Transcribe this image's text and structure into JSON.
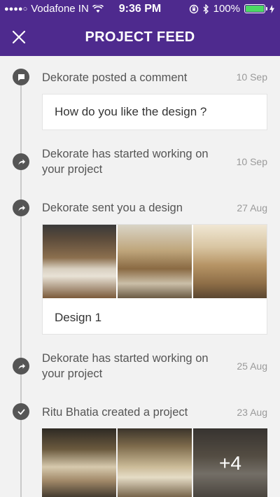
{
  "status_bar": {
    "carrier": "Vodafone IN",
    "time": "9:36 PM",
    "battery": "100%"
  },
  "app_bar": {
    "title": "PROJECT FEED"
  },
  "feed": [
    {
      "icon": "comment-icon",
      "text": "Dekorate posted a comment",
      "date": "10 Sep",
      "comment": "How do you like the design ?"
    },
    {
      "icon": "share-arrow-icon",
      "text": "Dekorate has started working on your project",
      "date": "10 Sep"
    },
    {
      "icon": "share-arrow-icon",
      "text": "Dekorate sent you a design",
      "date": "27 Aug",
      "design_label": "Design 1"
    },
    {
      "icon": "share-arrow-icon",
      "text": "Dekorate has started working on your project",
      "date": "25 Aug"
    },
    {
      "icon": "check-icon",
      "text": "Ritu Bhatia created a project",
      "date": "23 Aug",
      "more_count": "+4"
    }
  ],
  "colors": {
    "header": "#4e2a8e",
    "node": "#555555",
    "battery": "#4cd964"
  }
}
